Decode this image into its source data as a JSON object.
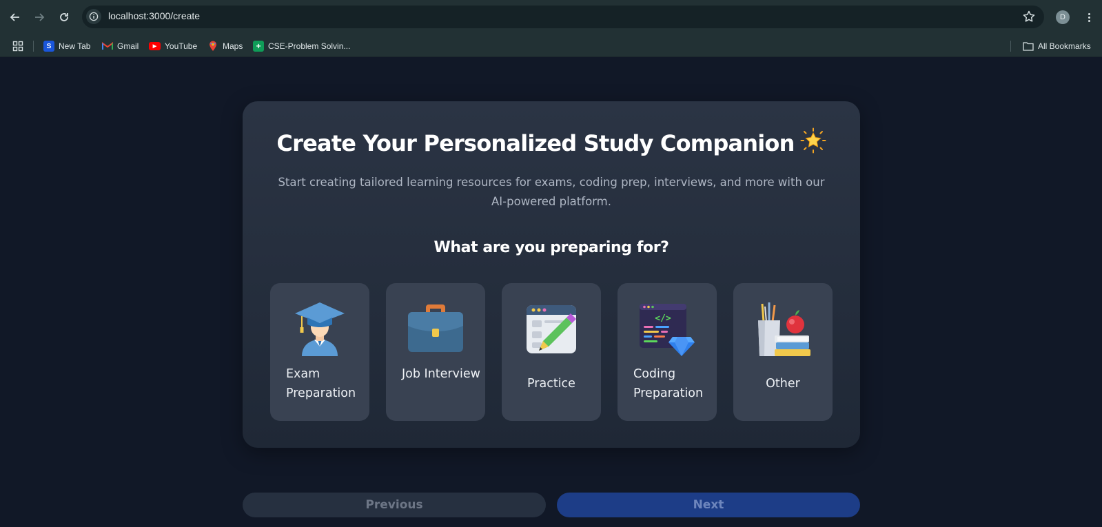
{
  "browser": {
    "url": "localhost:3000/create",
    "profile_initial": "D",
    "bookmarks": [
      {
        "label": "New Tab",
        "icon": "new-tab-icon",
        "color": "#1a56db",
        "glyph": "S"
      },
      {
        "label": "Gmail",
        "icon": "gmail-icon",
        "color": "#ea4335",
        "glyph": "M"
      },
      {
        "label": "YouTube",
        "icon": "youtube-icon",
        "color": "#ff0000",
        "glyph": "▶"
      },
      {
        "label": "Maps",
        "icon": "maps-icon",
        "color": "#34a853",
        "glyph": "●"
      },
      {
        "label": "CSE-Problem Solvin...",
        "icon": "sheets-icon",
        "color": "#0f9d58",
        "glyph": "+"
      }
    ],
    "all_bookmarks": "All Bookmarks"
  },
  "card": {
    "title": "Create Your Personalized Study Companion",
    "subtitle": "Start creating tailored learning resources for exams, coding prep, interviews, and more with our AI-powered platform.",
    "question": "What are you preparing for?",
    "options": [
      {
        "label": "Exam Preparation",
        "icon": "graduate-icon"
      },
      {
        "label": "Job Interview",
        "icon": "briefcase-icon"
      },
      {
        "label": "Practice",
        "icon": "practice-pencil-icon"
      },
      {
        "label": "Coding Preparation",
        "icon": "code-gem-icon"
      },
      {
        "label": "Other",
        "icon": "books-apple-icon"
      }
    ]
  },
  "footer": {
    "previous_label": "Previous",
    "next_label": "Next"
  },
  "colors": {
    "page_bg": "#111827",
    "card_bg": "#2b3444",
    "option_bg": "#394252",
    "next_bg": "#1d3d87",
    "prev_bg": "#263040"
  }
}
